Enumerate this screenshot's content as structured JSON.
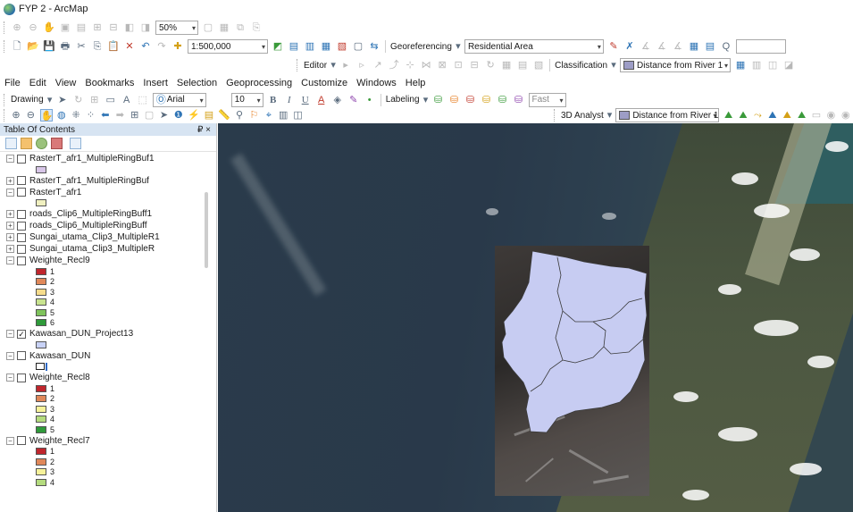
{
  "window": {
    "title": "FYP 2 - ArcMap"
  },
  "toolbar1": {
    "zoom_percent": "50%"
  },
  "toolbar2": {
    "scale": "1:500,000",
    "georeferencing_label": "Georeferencing",
    "georef_layer": "Residential Area"
  },
  "toolbar3": {
    "editor_label": "Editor",
    "classification_label": "Classification",
    "classification_layer": "Distance from River 1"
  },
  "menu": [
    "File",
    "Edit",
    "View",
    "Bookmarks",
    "Insert",
    "Selection",
    "Geoprocessing",
    "Customize",
    "Windows",
    "Help"
  ],
  "toolbar4": {
    "drawing_label": "Drawing",
    "font_name": "Arial",
    "font_size": "10",
    "bold": "B",
    "italic": "I",
    "underline": "U",
    "labeling_label": "Labeling",
    "label_quality": "Fast"
  },
  "toolbar5": {
    "analyst_label": "3D Analyst",
    "analyst_layer": "Distance from River 1"
  },
  "toc": {
    "title": "Table Of Contents",
    "pin": "₽ ×",
    "layers": [
      {
        "name": "RasterT_afr1_MultipleRingBuf1",
        "expanded": true,
        "checked": false,
        "legend": [
          {
            "label": "",
            "color": "#d8c6e8"
          }
        ]
      },
      {
        "name": "RasterT_afr1_MultipleRingBuf",
        "expanded": false,
        "checked": false,
        "legend": []
      },
      {
        "name": "RasterT_afr1",
        "expanded": true,
        "checked": false,
        "legend": [
          {
            "label": "",
            "color": "#f0f0c0"
          }
        ]
      },
      {
        "name": "roads_Clip6_MultipleRingBuff1",
        "expanded": false,
        "checked": false,
        "legend": []
      },
      {
        "name": "roads_Clip6_MultipleRingBuff",
        "expanded": false,
        "checked": false,
        "legend": []
      },
      {
        "name": "Sungai_utama_Clip3_MultipleR1",
        "expanded": false,
        "checked": false,
        "legend": []
      },
      {
        "name": "Sungai_utama_Clip3_MultipleR",
        "expanded": false,
        "checked": false,
        "legend": []
      },
      {
        "name": "Weighte_Recl9",
        "expanded": true,
        "checked": false,
        "legend": [
          {
            "label": "1",
            "color": "#c0262d"
          },
          {
            "label": "2",
            "color": "#e0885a"
          },
          {
            "label": "3",
            "color": "#f6dc8c"
          },
          {
            "label": "4",
            "color": "#c8e38f"
          },
          {
            "label": "5",
            "color": "#7fc35c"
          },
          {
            "label": "6",
            "color": "#2f9a3a"
          }
        ]
      },
      {
        "name": "Kawasan_DUN_Project13",
        "expanded": true,
        "checked": true,
        "legend": [
          {
            "label": "",
            "color": "#c8d2f6"
          }
        ]
      },
      {
        "name": "Kawasan_DUN",
        "expanded": true,
        "checked": false,
        "legend": [
          {
            "label": "",
            "color": "outline"
          }
        ]
      },
      {
        "name": "Weighte_Recl8",
        "expanded": true,
        "checked": false,
        "legend": [
          {
            "label": "1",
            "color": "#c0262d"
          },
          {
            "label": "2",
            "color": "#e0885a"
          },
          {
            "label": "3",
            "color": "#f6f29a"
          },
          {
            "label": "4",
            "color": "#b4db7e"
          },
          {
            "label": "5",
            "color": "#2f9a3a"
          }
        ]
      },
      {
        "name": "Weighte_Recl7",
        "expanded": true,
        "checked": false,
        "legend": [
          {
            "label": "1",
            "color": "#c0262d"
          },
          {
            "label": "2",
            "color": "#e0885a"
          },
          {
            "label": "3",
            "color": "#f6f29a"
          },
          {
            "label": "4",
            "color": "#b4db7e"
          }
        ]
      }
    ]
  },
  "map": {
    "polygon_fill": "#c7ccf2",
    "polygon_stroke": "#3a3a3a"
  }
}
